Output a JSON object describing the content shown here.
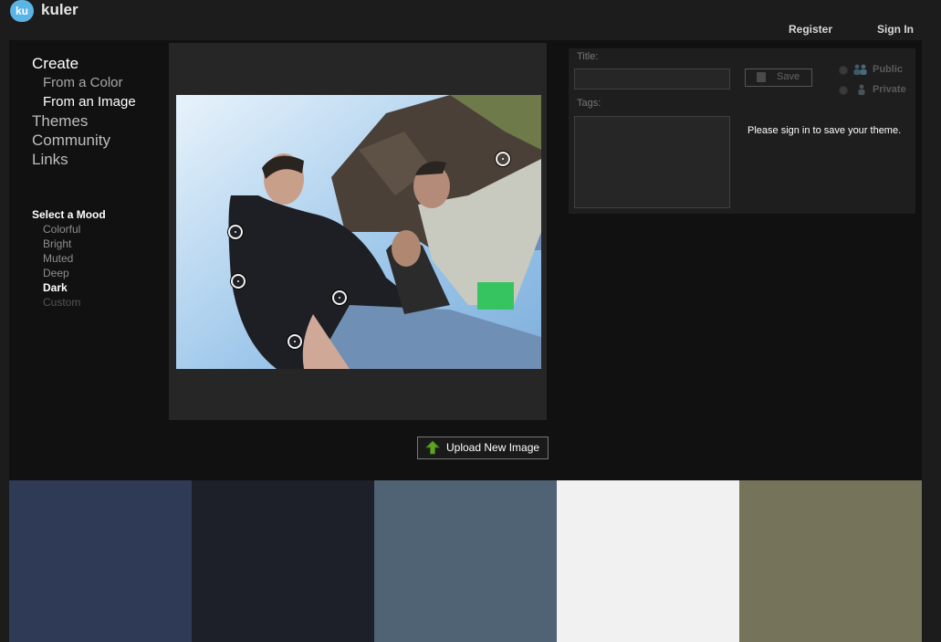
{
  "app": {
    "logo_badge": "ku",
    "name": "kuler"
  },
  "header": {
    "register": "Register",
    "sign_in": "Sign In"
  },
  "nav": {
    "create": "Create",
    "from_color": "From a Color",
    "from_image": "From an Image",
    "themes": "Themes",
    "community": "Community",
    "links": "Links"
  },
  "mood": {
    "heading": "Select a Mood",
    "options": [
      "Colorful",
      "Bright",
      "Muted",
      "Deep",
      "Dark",
      "Custom"
    ],
    "selected": "Dark"
  },
  "upload": {
    "label": "Upload New Image",
    "icon": "upload-arrow-icon"
  },
  "form": {
    "title_label": "Title:",
    "title_value": "",
    "tags_label": "Tags:",
    "tags_value": "",
    "save_label": "Save",
    "public_label": "Public",
    "private_label": "Private",
    "signin_message": "Please sign in to save your theme."
  },
  "swatches": [
    "#2e3a56",
    "#1e2029",
    "#506374",
    "#f1f1f1",
    "#75745a"
  ]
}
